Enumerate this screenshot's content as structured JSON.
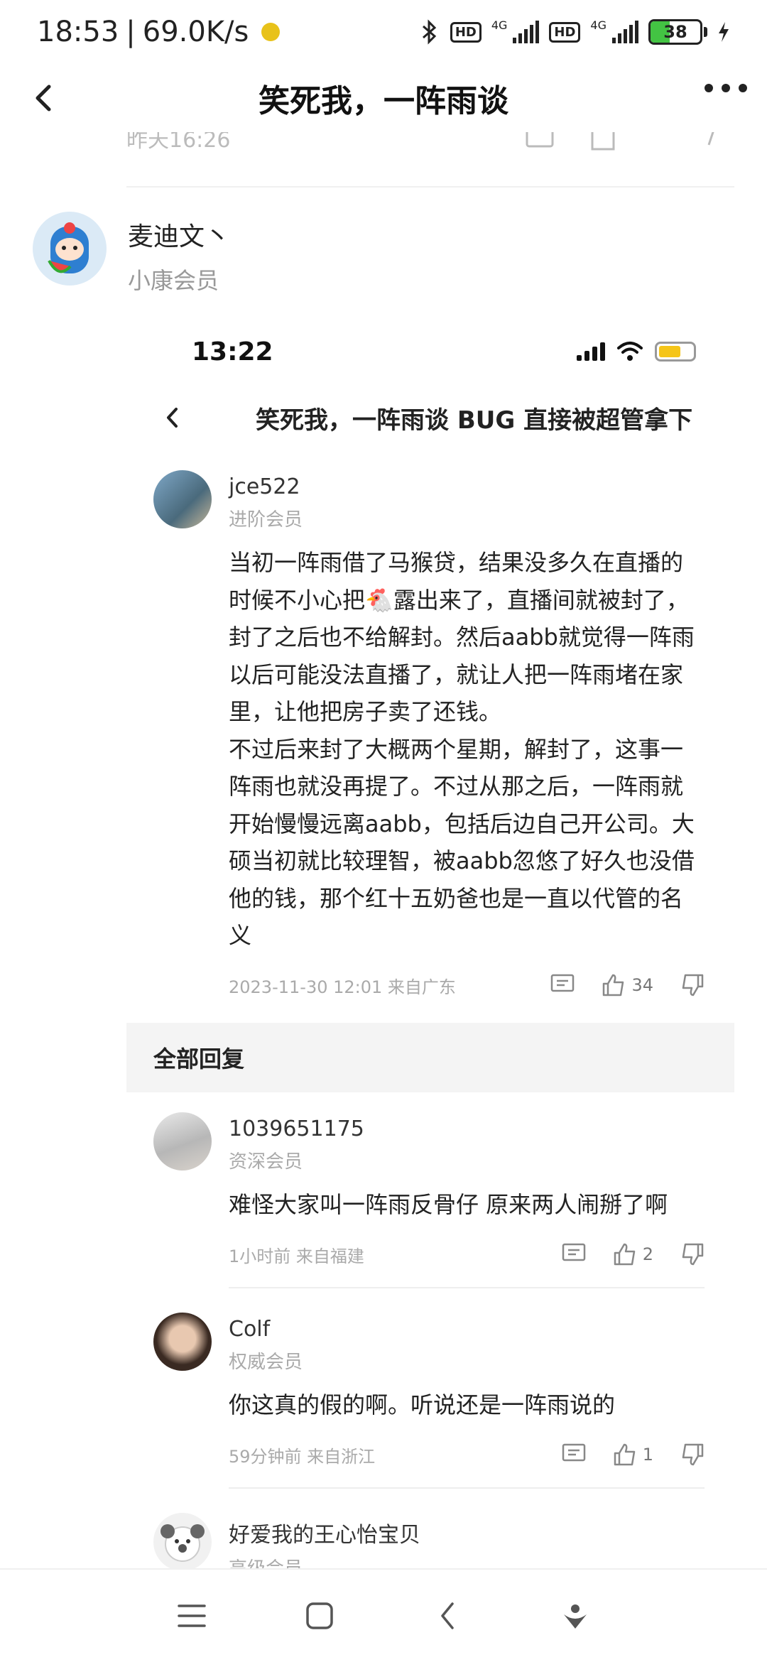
{
  "status_bar": {
    "time": "18:53",
    "net_speed": "69.0K/s",
    "network_1": "4G",
    "network_2": "4G",
    "battery": "38"
  },
  "header": {
    "title": "笑死我，一阵雨谈"
  },
  "previous_item": {
    "timestamp": "昨天16:26"
  },
  "poster": {
    "name": "麦迪文丶",
    "level": "小康会员"
  },
  "embedded": {
    "time": "13:22",
    "title": "笑死我，一阵雨谈 BUG 直接被超管拿下",
    "main_comment": {
      "name": "jce522",
      "level": "进阶会员",
      "lines": [
        "当初一阵雨借了马猴贷，结果没多久在直播的",
        "时候不小心把🐔露出来了，直播间就被封了，",
        "封了之后也不给解封。然后aabb就觉得一阵雨",
        "以后可能没法直播了，就让人把一阵雨堵在家",
        "里，让他把房子卖了还钱。",
        "不过后来封了大概两个星期，解封了，这事一",
        "阵雨也就没再提了。不过从那之后，一阵雨就",
        "开始慢慢远离aabb，包括后边自己开公司。大",
        "硕当初就比较理智，被aabb忽悠了好久也没借",
        "他的钱，那个红十五奶爸也是一直以代管的名",
        "义"
      ],
      "date": "2023-11-30 12:01 来自广东",
      "likes": "34"
    },
    "section_title": "全部回复",
    "replies": [
      {
        "name": "1039651175",
        "level": "资深会员",
        "text": "难怪大家叫一阵雨反骨仔 原来两人闹掰了啊",
        "date": "1小时前 来自福建",
        "likes": "2"
      },
      {
        "name": "Colf",
        "level": "权威会员",
        "text": "你这真的假的啊。听说还是一阵雨说的",
        "date": "59分钟前 来自浙江",
        "likes": "1"
      },
      {
        "name": "好爱我的王心怡宝贝",
        "level": "高级会员"
      }
    ]
  }
}
